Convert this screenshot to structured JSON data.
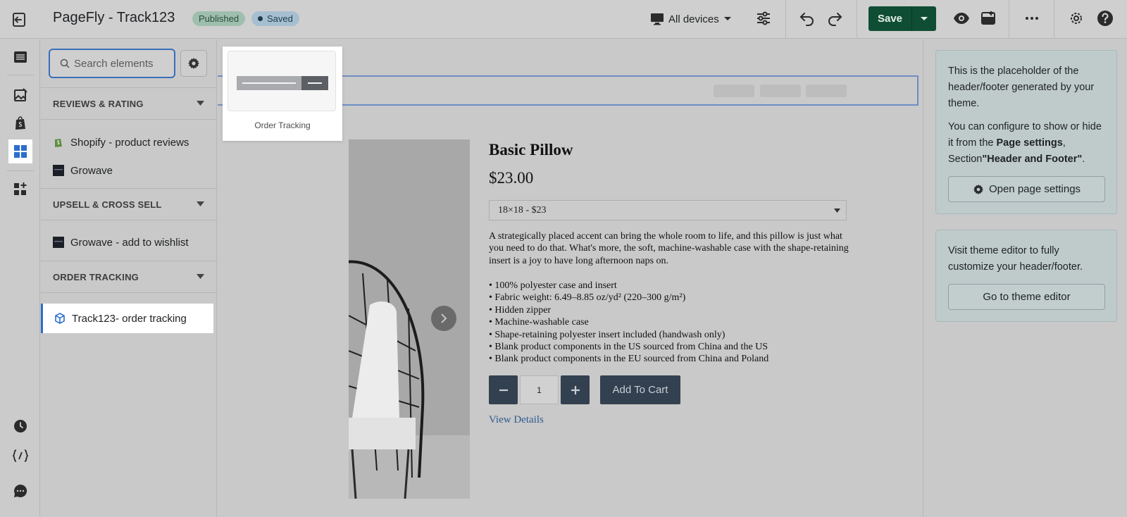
{
  "header": {
    "title": "PageFly - Track123",
    "published_badge": "Published",
    "saved_badge": "Saved",
    "device_selector": "All devices",
    "save_label": "Save"
  },
  "rail": {
    "items": [
      "pages-icon",
      "image-icon",
      "shopify-icon",
      "elements-icon",
      "add-section-icon",
      "history-icon",
      "code-icon",
      "chat-icon"
    ],
    "active": "elements-icon"
  },
  "element_panel": {
    "search_placeholder": "Search elements",
    "sections": [
      {
        "title": "REVIEWS & RATING",
        "items": [
          "Shopify - product reviews",
          "Growave"
        ]
      },
      {
        "title": "UPSELL & CROSS SELL",
        "items": [
          "Growave - add to wishlist"
        ]
      },
      {
        "title": "ORDER TRACKING",
        "items": [
          "Track123- order tracking"
        ]
      }
    ]
  },
  "preview": {
    "label": "Order Tracking"
  },
  "product": {
    "title": "Basic Pillow",
    "price": "$23.00",
    "variant": "18×18 - $23",
    "description": "A strategically placed accent can bring the whole room to life, and this pillow is just what you need to do that. What's more, the soft, machine-washable case with the shape-retaining insert is a joy to have long afternoon naps on.",
    "bullets": [
      "• 100% polyester case and insert",
      "• Fabric weight: 6.49–8.85 oz/yd² (220–300 g/m²)",
      "• Hidden zipper",
      "• Machine-washable case",
      "• Shape-retaining polyester insert included (handwash only)",
      "• Blank product components in the US sourced from China and the US",
      "• Blank product components in the EU sourced from China and Poland"
    ],
    "quantity": "1",
    "add_to_cart": "Add To Cart",
    "view_details": "View Details"
  },
  "right_panel": {
    "card1": {
      "text1": "This is the placeholder of the header/footer generated by your theme.",
      "text2_pre": "You can configure to show or hide it from the ",
      "text2_bold1": "Page settings",
      "text2_mid": ", Section",
      "text2_bold2": "\"Header and Footer\"",
      "text2_end": ".",
      "button": "Open page settings"
    },
    "card2": {
      "text": "Visit theme editor to fully customize your header/footer.",
      "button": "Go to theme editor"
    }
  },
  "colors": {
    "save": "#0f4e34",
    "accent": "#2c6ecb",
    "cart_button": "#334050"
  }
}
